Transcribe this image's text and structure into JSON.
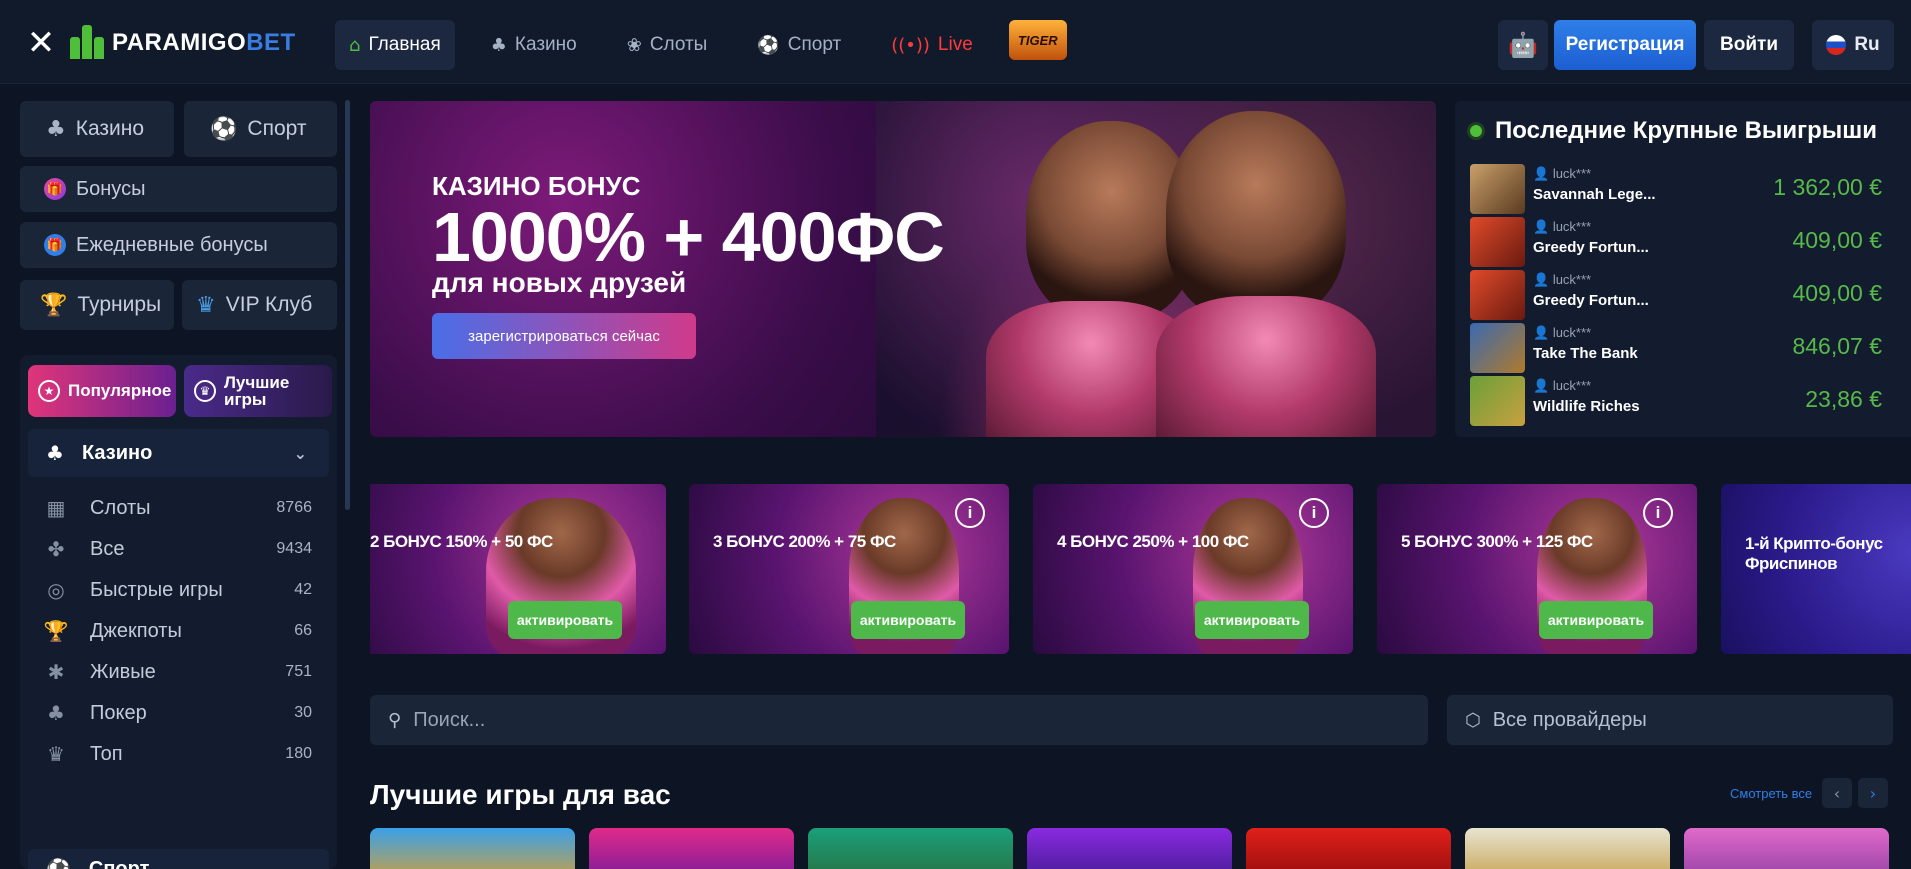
{
  "header": {
    "logo_a": "PARAMIGO",
    "logo_b": "BET",
    "nav": [
      {
        "label": "Главная",
        "icon": "home-icon",
        "active": true
      },
      {
        "label": "Казино",
        "icon": "cards-icon"
      },
      {
        "label": "Слоты",
        "icon": "slots-icon"
      },
      {
        "label": "Спорт",
        "icon": "football-icon"
      },
      {
        "label": "Live",
        "icon": "live-icon"
      }
    ],
    "tiger_badge": "TIGER",
    "register": "Регистрация",
    "login": "Войти",
    "lang": "Ru"
  },
  "sidebar": {
    "casino": "Казино",
    "sport": "Спорт",
    "bonuses": "Бонусы",
    "daily_bonuses": "Ежедневные бонусы",
    "tournaments": "Турниры",
    "vip": "VIP Клуб",
    "popular": "Популярное",
    "best_games": "Лучшие игры",
    "category_head": "Казино",
    "categories": [
      {
        "label": "Слоты",
        "count": "8766",
        "icon": "slot-machine-icon"
      },
      {
        "label": "Все",
        "count": "9434",
        "icon": "all-games-icon"
      },
      {
        "label": "Быстрые игры",
        "count": "42",
        "icon": "fast-games-icon"
      },
      {
        "label": "Джекпоты",
        "count": "66",
        "icon": "trophy-icon"
      },
      {
        "label": "Живые",
        "count": "751",
        "icon": "live-dealer-icon"
      },
      {
        "label": "Покер",
        "count": "30",
        "icon": "poker-icon"
      },
      {
        "label": "Топ",
        "count": "180",
        "icon": "crown-icon"
      }
    ],
    "category_foot": "Спорт"
  },
  "hero": {
    "label": "КАЗИНО БОНУС",
    "title": "1000% + 400ФС",
    "subtitle": "для новых друзей",
    "cta": "зарегистрироваться сейчас"
  },
  "wins": {
    "title": "Последние Крупные Выигрыши",
    "items": [
      {
        "user": "luck***",
        "game": "Savannah Lege...",
        "amount": "1 362,00 €"
      },
      {
        "user": "luck***",
        "game": "Greedy Fortun...",
        "amount": "409,00 €"
      },
      {
        "user": "luck***",
        "game": "Greedy Fortun...",
        "amount": "409,00 €"
      },
      {
        "user": "luck***",
        "game": "Take The Bank",
        "amount": "846,07 €"
      },
      {
        "user": "luck***",
        "game": "Wildlife Riches",
        "amount": "23,86 €"
      }
    ]
  },
  "promos": [
    {
      "text": "2 БОНУС 150% + 50 ФС",
      "button": "активировать"
    },
    {
      "text": "3 БОНУС 200% + 75 ФС",
      "button": "активировать"
    },
    {
      "text": "4 БОНУС 250% + 100 ФС",
      "button": "активировать"
    },
    {
      "text": "5 БОНУС 300% + 125 ФС",
      "button": "активировать"
    },
    {
      "text": "1-й Крипто-бонус Фриспинов",
      "button": ""
    }
  ],
  "search": {
    "placeholder": "Поиск..."
  },
  "providers": "Все провайдеры",
  "best_games": {
    "title": "Лучшие игры для вас",
    "see_all": "Смотреть все"
  },
  "colors": {
    "accent_blue": "#2f7fe8",
    "win_green": "#57b94a",
    "live_red": "#ff3a3a",
    "bg": "#0d1524"
  }
}
